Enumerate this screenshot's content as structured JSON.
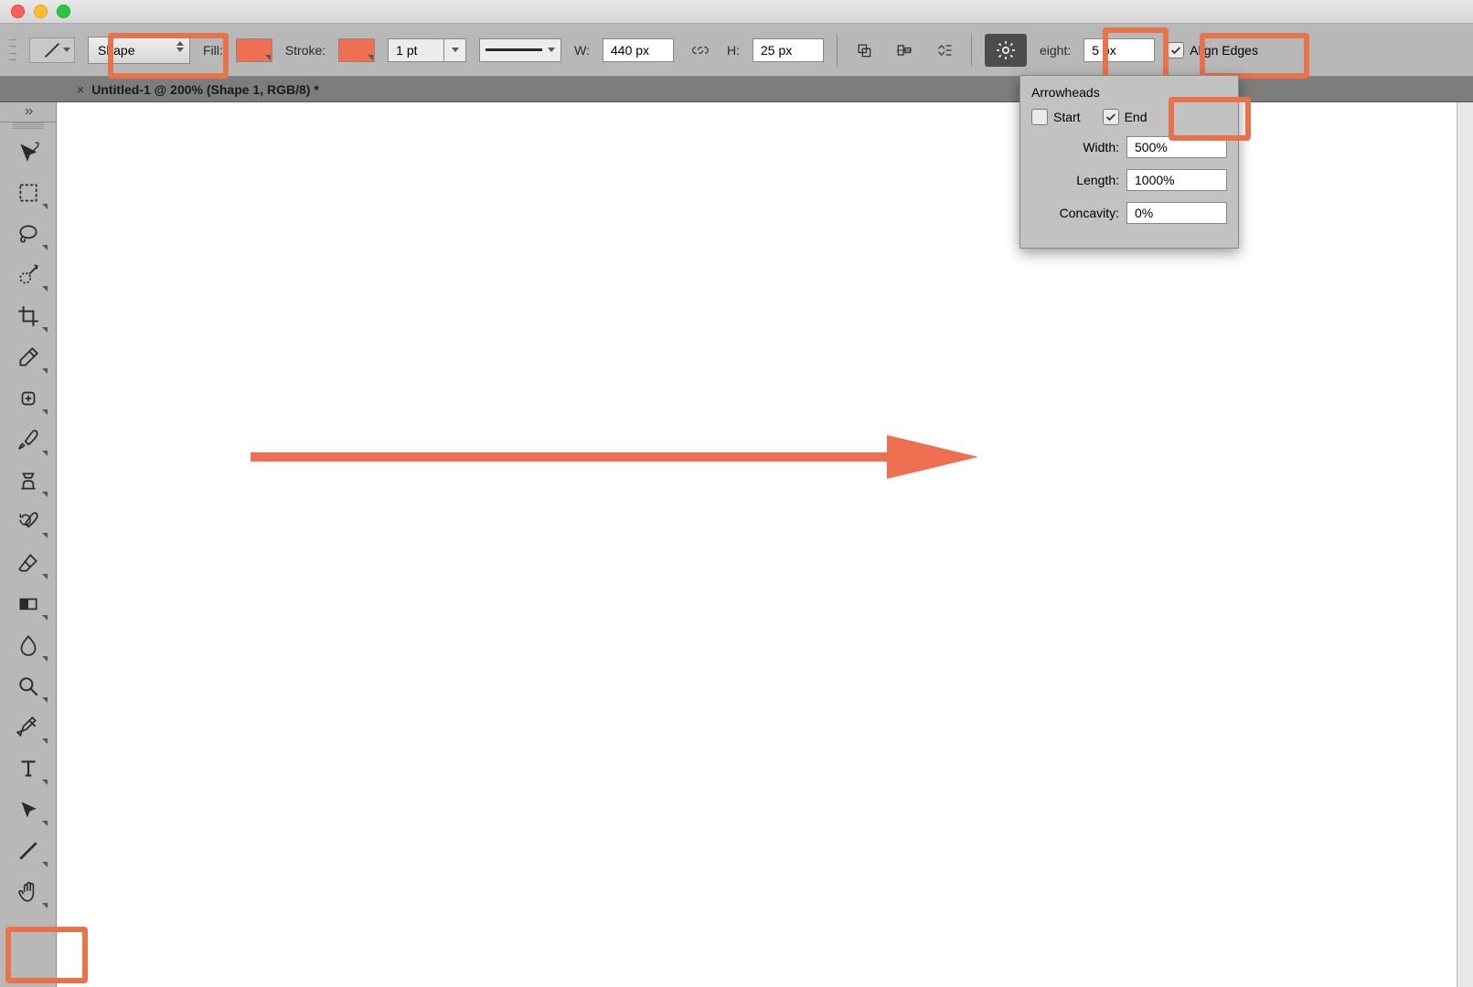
{
  "optionsBar": {
    "shapeModeLabel": "Shape",
    "fillLabel": "Fill:",
    "fillColor": "#ee6f52",
    "strokeLabel": "Stroke:",
    "strokeColor": "#ee6f52",
    "strokeWeight": "1 pt",
    "widthLabel": "W:",
    "widthValue": "440 px",
    "heightLabel": "H:",
    "heightValue": "25 px",
    "weightLabel": "eight:",
    "weightValue": "5 px",
    "alignEdgesLabel": "Align Edges",
    "alignEdgesChecked": true
  },
  "arrowheadsPanel": {
    "title": "Arrowheads",
    "startLabel": "Start",
    "startChecked": false,
    "endLabel": "End",
    "endChecked": true,
    "widthLabel": "Width:",
    "widthValue": "500%",
    "lengthLabel": "Length:",
    "lengthValue": "1000%",
    "concavityLabel": "Concavity:",
    "concavityValue": "0%"
  },
  "documentTab": {
    "title": "Untitled-1 @ 200% (Shape 1, RGB/8) *"
  },
  "tools": [
    {
      "name": "move-tool",
      "hasCorner": false
    },
    {
      "name": "rectangular-marquee-tool",
      "hasCorner": true
    },
    {
      "name": "lasso-tool",
      "hasCorner": true
    },
    {
      "name": "quick-selection-tool",
      "hasCorner": true
    },
    {
      "name": "crop-tool",
      "hasCorner": true
    },
    {
      "name": "eyedropper-tool",
      "hasCorner": true
    },
    {
      "name": "healing-brush-tool",
      "hasCorner": true
    },
    {
      "name": "brush-tool",
      "hasCorner": true
    },
    {
      "name": "clone-stamp-tool",
      "hasCorner": true
    },
    {
      "name": "history-brush-tool",
      "hasCorner": true
    },
    {
      "name": "eraser-tool",
      "hasCorner": true
    },
    {
      "name": "gradient-tool",
      "hasCorner": true
    },
    {
      "name": "blur-tool",
      "hasCorner": true
    },
    {
      "name": "dodge-tool",
      "hasCorner": true
    },
    {
      "name": "pen-tool",
      "hasCorner": true
    },
    {
      "name": "type-tool",
      "hasCorner": true
    },
    {
      "name": "path-selection-tool",
      "hasCorner": true
    },
    {
      "name": "line-tool",
      "hasCorner": true
    },
    {
      "name": "hand-tool",
      "hasCorner": true
    }
  ],
  "canvasArrow": {
    "color": "#ee6f52"
  }
}
